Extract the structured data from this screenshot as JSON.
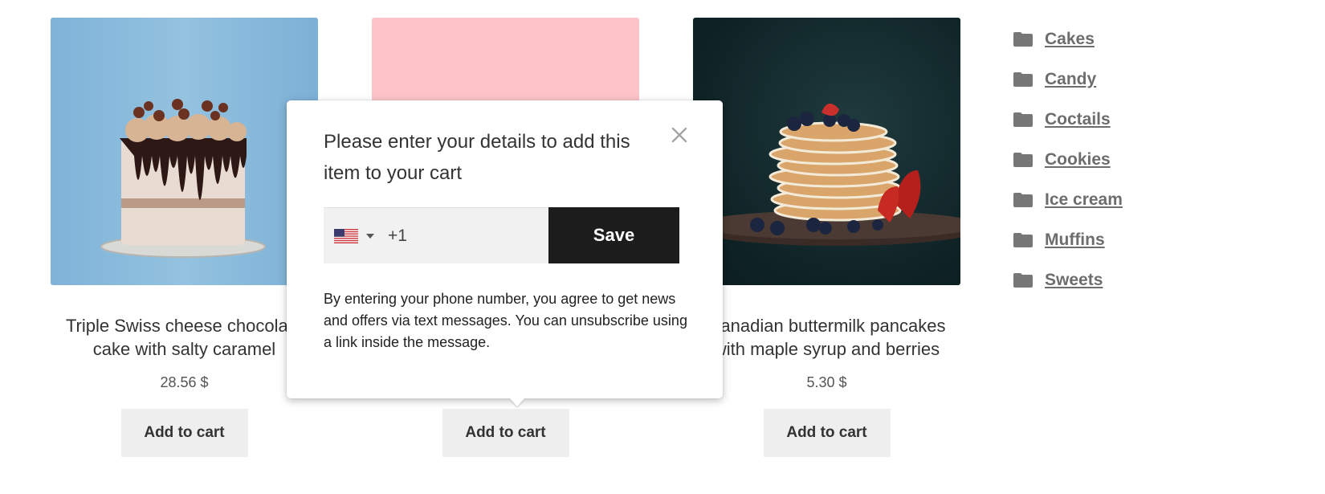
{
  "products": [
    {
      "title": "Triple Swiss cheese chocolate cake with salty caramel",
      "price": "28.56 $",
      "add_label": "Add to cart",
      "image": "chocolate-drip-cake-photo",
      "image_bg": "#8fbedd"
    },
    {
      "title": "",
      "price": "",
      "add_label": "Add to cart",
      "image": "pink-placeholder-photo",
      "image_bg": "#fcc3c8"
    },
    {
      "title": "Canadian buttermilk pancakes with maple syrup and berries",
      "price": "5.30 $",
      "add_label": "Add to cart",
      "image": "pancake-stack-photo",
      "image_bg": "#12292c"
    }
  ],
  "categories": {
    "icon": "folder-icon",
    "items": [
      {
        "label": "Cakes"
      },
      {
        "label": "Candy"
      },
      {
        "label": "Coctails"
      },
      {
        "label": "Cookies"
      },
      {
        "label": "Ice cream"
      },
      {
        "label": "Muffins"
      },
      {
        "label": "Sweets"
      }
    ]
  },
  "popup": {
    "heading": "Please enter your details to add this item to your cart",
    "close_icon": "close-icon",
    "phone": {
      "country_flag": "us-flag-icon",
      "dial_code": "+1",
      "placeholder": ""
    },
    "save_label": "Save",
    "consent_text": "By entering your phone number, you agree to get news and offers via text messages. You can unsubscribe using a link inside the message."
  },
  "colors": {
    "button_bg": "#eeeeee",
    "save_bg": "#1c1c1c",
    "category_link": "#6d6d6d"
  }
}
